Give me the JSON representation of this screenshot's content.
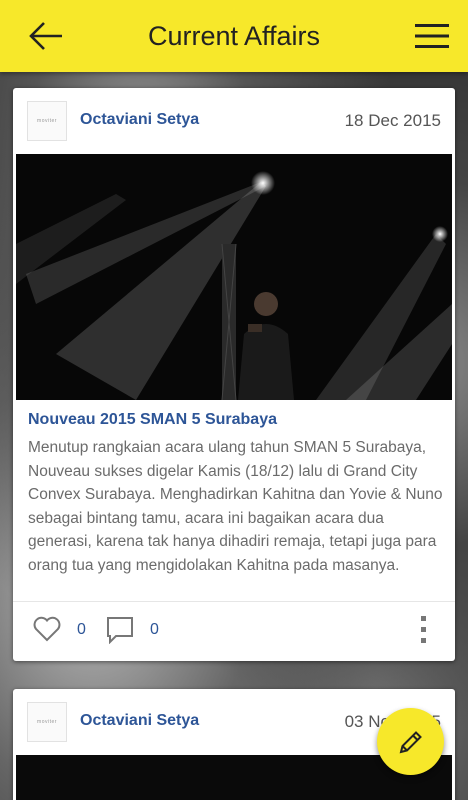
{
  "header": {
    "title": "Current Affairs",
    "back_icon": "arrow-left-icon",
    "menu_icon": "hamburger-menu-icon",
    "background_color": "#f7e82a"
  },
  "posts": [
    {
      "avatar_text": "moviter",
      "author": "Octaviani Setya",
      "date": "18 Dec 2015",
      "title": "Nouveau 2015 SMAN 5 Surabaya",
      "body": "Menutup rangkaian acara ulang tahun SMAN 5 Surabaya, Nouveau sukses digelar Kamis (18/12) lalu di Grand City Convex Surabaya. Menghadirkan Kahitna dan Yovie & Nuno sebagai bintang tamu, acara ini bagaikan acara dua generasi, karena tak hanya dihadiri remaja, tetapi juga para orang tua yang mengidolakan Kahitna pada masanya.",
      "likes": "0",
      "comments": "0"
    },
    {
      "avatar_text": "moviter",
      "author": "Octaviani Setya",
      "date": "03 Nov 2015"
    }
  ],
  "fab": {
    "icon": "pencil-icon"
  },
  "colors": {
    "accent": "#f7e82a",
    "link_blue": "#2d5597",
    "body_text": "#6b6b6b"
  }
}
